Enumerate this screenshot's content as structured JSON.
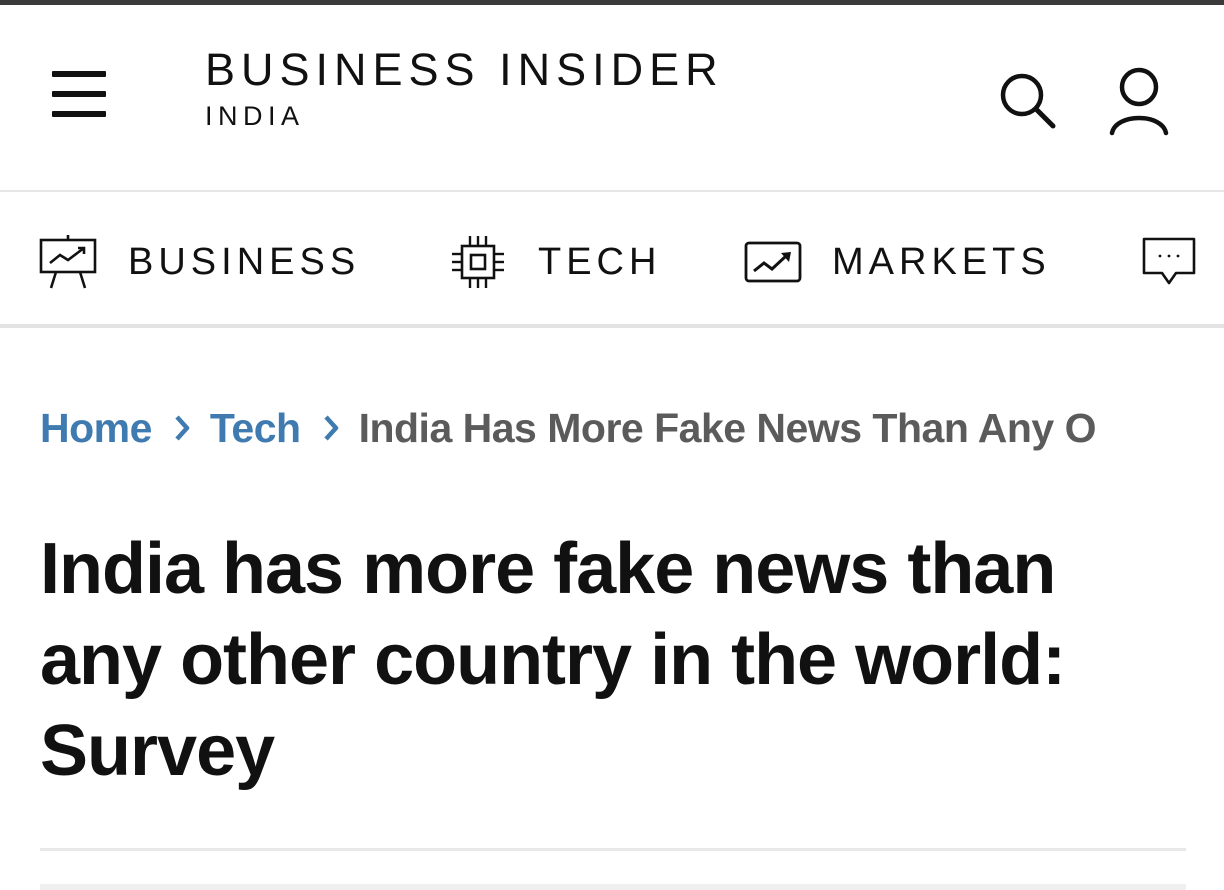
{
  "header": {
    "menu_icon": "hamburger-menu-icon",
    "logo_main": "BUSINESS INSIDER",
    "logo_sub": "INDIA",
    "search_icon": "search-icon",
    "user_icon": "user-account-icon"
  },
  "category_nav": {
    "items": [
      {
        "label": "BUSINESS",
        "icon": "presentation-board-icon"
      },
      {
        "label": "TECH",
        "icon": "microchip-icon"
      },
      {
        "label": "MARKETS",
        "icon": "market-trend-icon"
      },
      {
        "label": "",
        "icon": "chat-bubble-icon"
      }
    ]
  },
  "breadcrumb": {
    "home": "Home",
    "separator": "›",
    "section": "Tech",
    "current": "India Has More Fake News Than Any O"
  },
  "article": {
    "headline": "India has more fake news than any other country in the world: Survey"
  },
  "colors": {
    "breadcrumb_link": "#3f7bb0",
    "breadcrumb_current": "#5b5b5b",
    "text": "#111111"
  }
}
